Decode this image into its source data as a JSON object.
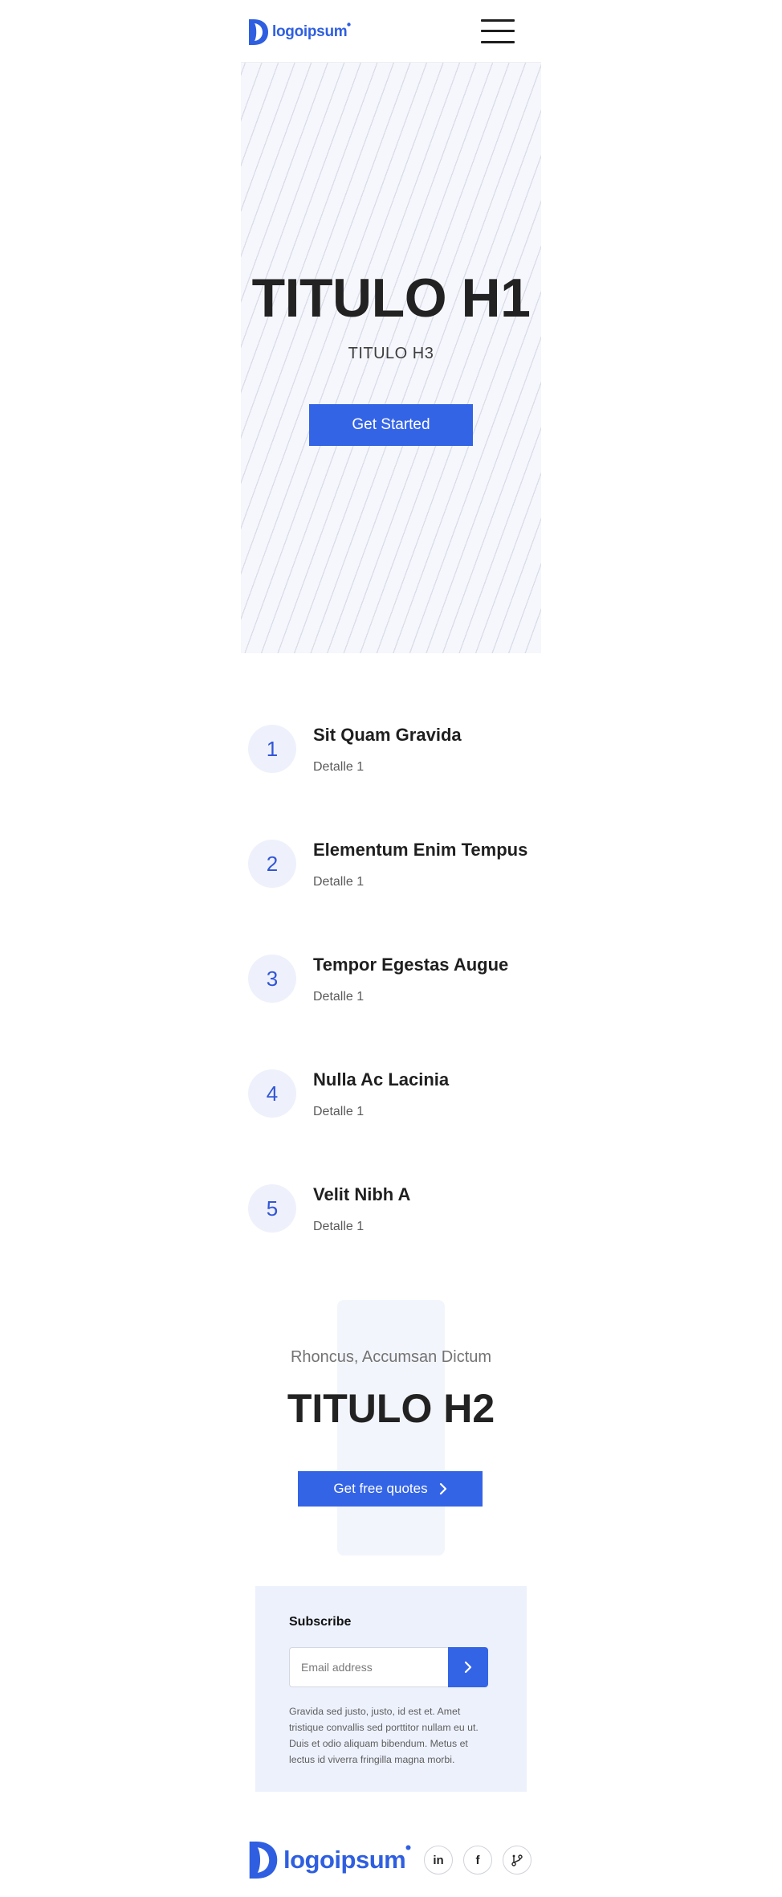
{
  "brand": {
    "logo_text": "logoipsum",
    "accent_color": "#3464e6"
  },
  "header": {
    "menu_icon": "hamburger-menu-icon"
  },
  "hero": {
    "title": "TITULO H1",
    "subtitle": "TITULO H3",
    "cta_label": "Get Started"
  },
  "features": {
    "items": [
      {
        "number": "1",
        "title": "Sit Quam Gravida",
        "detail": "Detalle 1"
      },
      {
        "number": "2",
        "title": "Elementum Enim Tempus",
        "detail": "Detalle 1"
      },
      {
        "number": "3",
        "title": "Tempor Egestas Augue",
        "detail": "Detalle 1"
      },
      {
        "number": "4",
        "title": "Nulla Ac Lacinia",
        "detail": "Detalle 1"
      },
      {
        "number": "5",
        "title": "Velit Nibh A",
        "detail": "Detalle 1"
      }
    ]
  },
  "cta": {
    "kicker": "Rhoncus, Accumsan Dictum",
    "title": "TITULO H2",
    "button_label": "Get free quotes",
    "button_icon": "chevron-right-icon"
  },
  "subscribe": {
    "title": "Subscribe",
    "email_placeholder": "Email address",
    "submit_icon": "chevron-right-icon",
    "description": "Gravida sed justo, justo, id est et. Amet tristique convallis sed porttitor nullam eu ut. Duis et odio aliquam bibendum. Metus et lectus id viverra fringilla magna morbi."
  },
  "footer": {
    "logo_text": "logoipsum",
    "social": [
      {
        "icon": "linkedin-icon",
        "glyph": "in"
      },
      {
        "icon": "facebook-icon",
        "glyph": "f"
      },
      {
        "icon": "branch-icon",
        "glyph": ""
      }
    ]
  }
}
